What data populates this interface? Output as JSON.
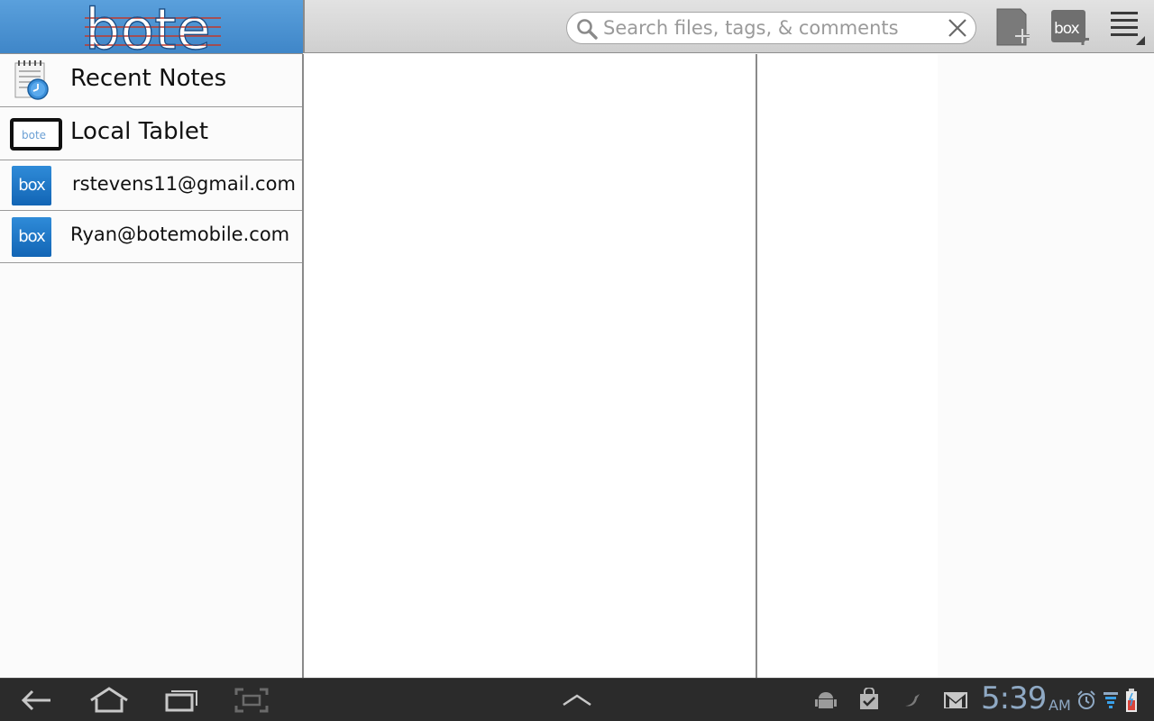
{
  "app": {
    "logo_text": "bote"
  },
  "search": {
    "placeholder": "Search files, tags, & comments",
    "value": ""
  },
  "toolbar": {
    "icons": [
      "search-icon",
      "clear-icon",
      "new-note-icon",
      "new-box-note-icon",
      "overflow-menu-icon"
    ],
    "box_icon_text": "box"
  },
  "sidebar": {
    "items": [
      {
        "label": "Recent Notes",
        "icon": "recent-notes-icon"
      },
      {
        "label": "Local Tablet",
        "icon": "tablet-icon"
      },
      {
        "label": "rstevens11@gmail.com",
        "icon": "box-icon",
        "icon_text": "box"
      },
      {
        "label": "Ryan@botemobile.com",
        "icon": "box-icon",
        "icon_text": "box"
      }
    ]
  },
  "system_bar": {
    "time": "5:39",
    "ampm": "AM",
    "icons": [
      "back-icon",
      "home-icon",
      "recent-apps-icon",
      "screenshot-icon",
      "up-arrow-icon",
      "android-debug-icon",
      "market-icon",
      "twitter-icon",
      "gmail-icon",
      "alarm-icon",
      "wifi-icon",
      "battery-icon"
    ]
  },
  "colors": {
    "header_blue": "#3f86c8",
    "box_blue": "#1265b5",
    "clock": "#8fa9c4",
    "system_bar": "#2b2b2b"
  }
}
